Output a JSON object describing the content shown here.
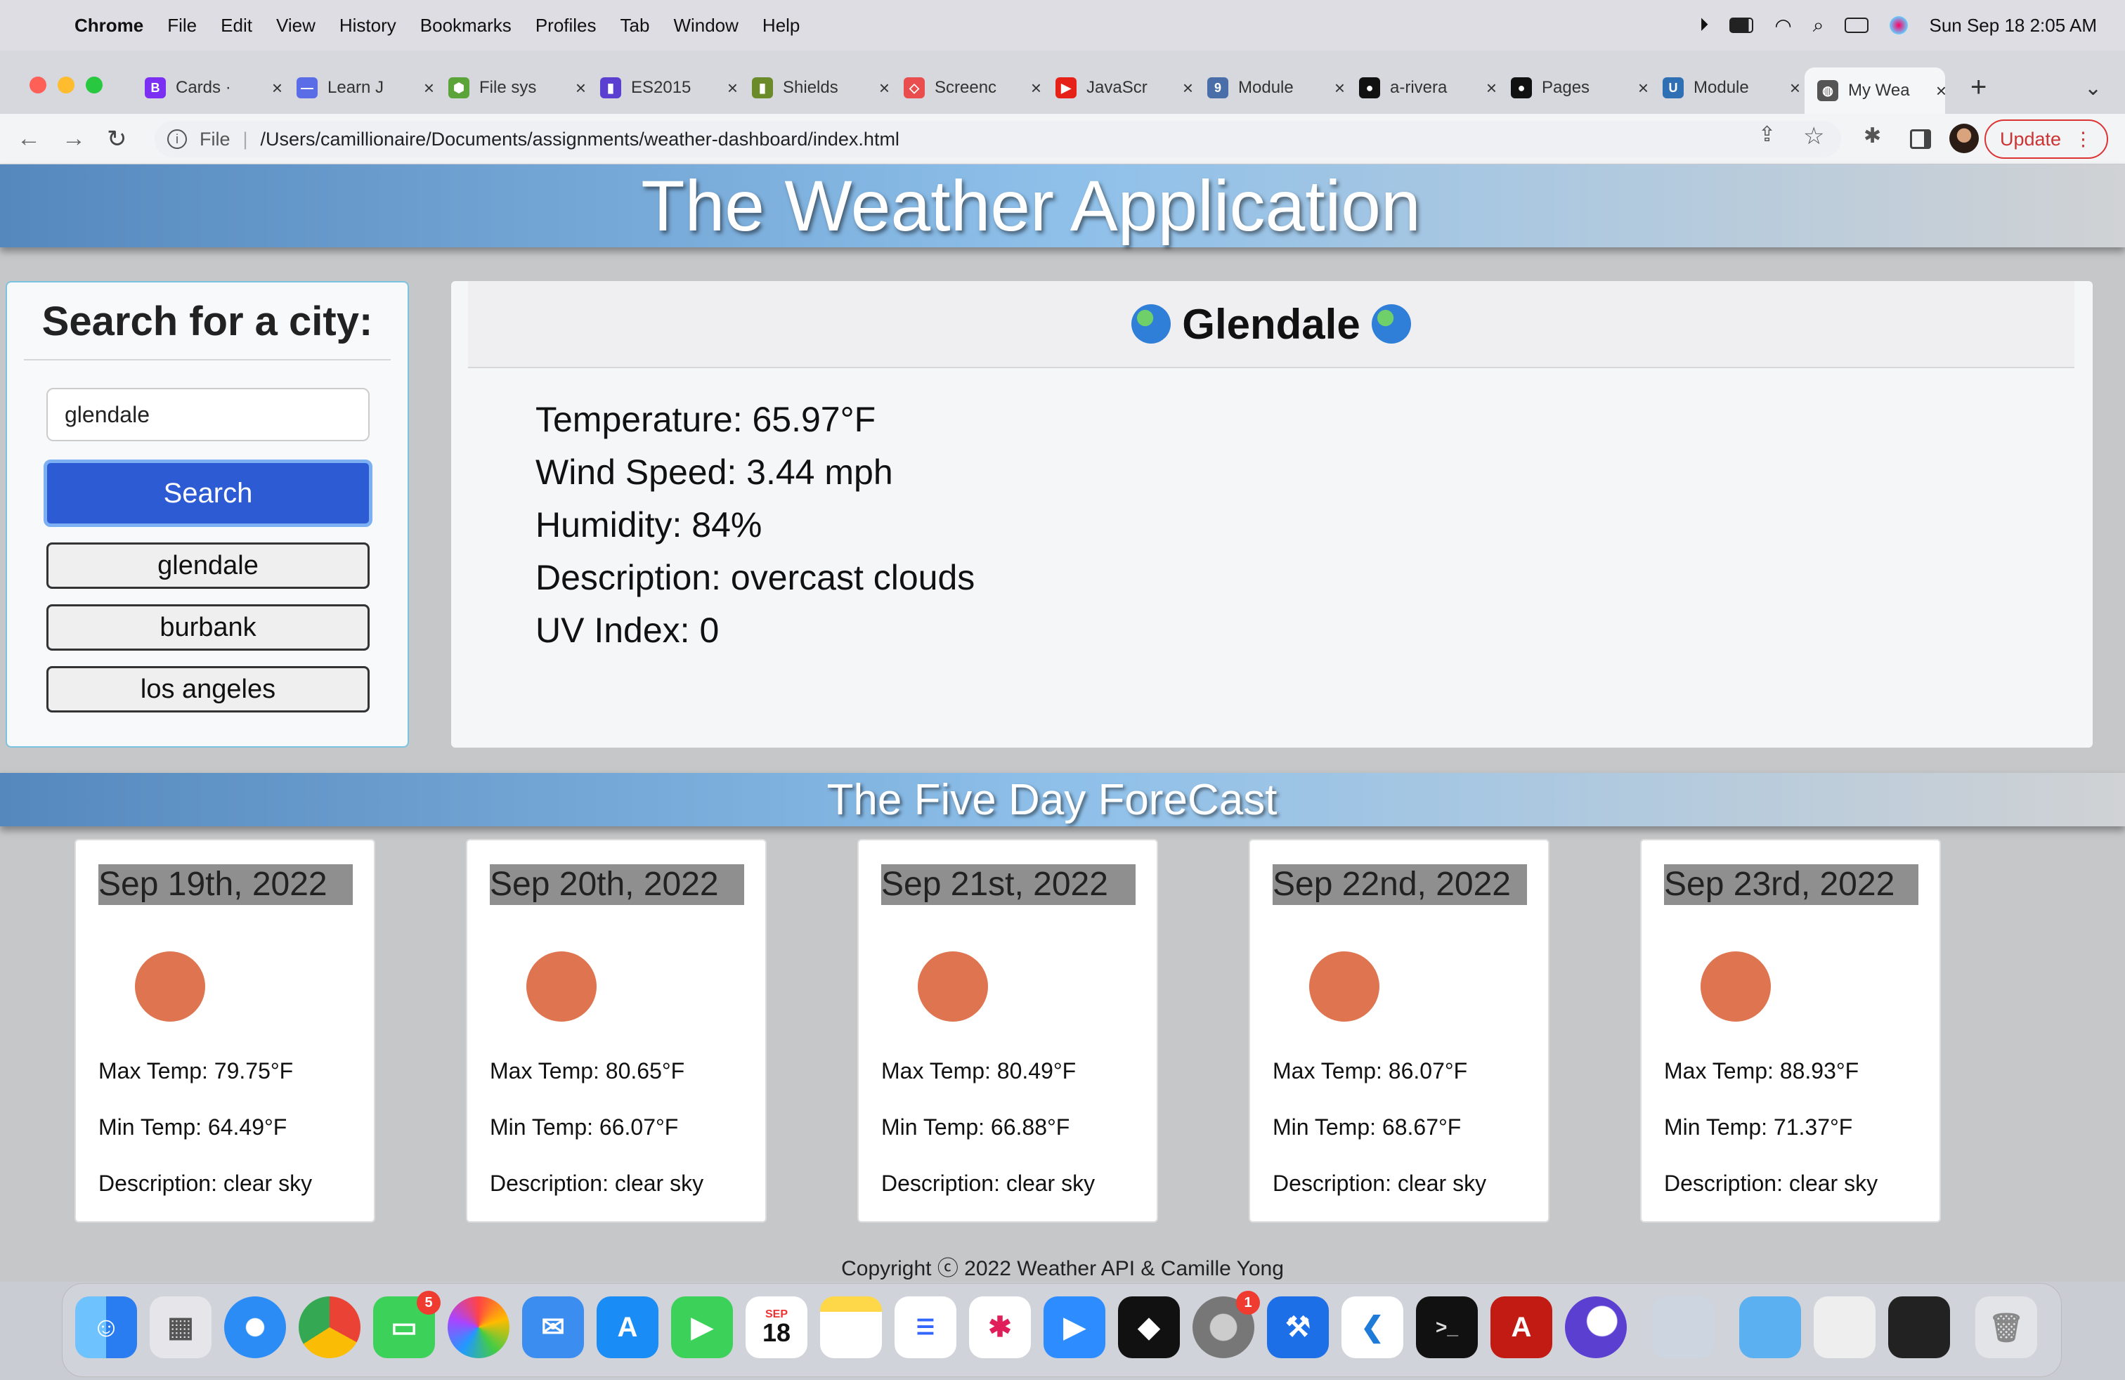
{
  "menubar": {
    "app": "Chrome",
    "items": [
      "File",
      "Edit",
      "View",
      "History",
      "Bookmarks",
      "Profiles",
      "Tab",
      "Window",
      "Help"
    ],
    "clock": "Sun Sep 18  2:05 AM"
  },
  "tabs": [
    {
      "label": "Cards ·",
      "icon": "bootstrap-icon",
      "color": "#7b2ff2",
      "glyph": "B"
    },
    {
      "label": "Learn J",
      "icon": "learn-icon",
      "color": "#5b6de6",
      "glyph": "—"
    },
    {
      "label": "File sys",
      "icon": "node-icon",
      "color": "#5aa43a",
      "glyph": "⬢"
    },
    {
      "label": "ES2015",
      "icon": "es-icon",
      "color": "#5b3fd1",
      "glyph": "▮"
    },
    {
      "label": "Shields",
      "icon": "shields-icon",
      "color": "#6b8b2b",
      "glyph": "▮"
    },
    {
      "label": "Screenc",
      "icon": "screencast-icon",
      "color": "#e94d4d",
      "glyph": "◇"
    },
    {
      "label": "JavaScr",
      "icon": "youtube-icon",
      "color": "#e62117",
      "glyph": "▶"
    },
    {
      "label": "Module",
      "icon": "module-icon",
      "color": "#4a6ea8",
      "glyph": "9"
    },
    {
      "label": "a-rivera",
      "icon": "github-icon",
      "color": "#111",
      "glyph": "●"
    },
    {
      "label": "Pages",
      "icon": "github-icon",
      "color": "#111",
      "glyph": "●"
    },
    {
      "label": "Module",
      "icon": "ucla-icon",
      "color": "#2f6fb4",
      "glyph": "U"
    },
    {
      "label": "My Wea",
      "icon": "globe-icon",
      "color": "#555",
      "glyph": "◍"
    }
  ],
  "address": {
    "scheme": "File",
    "url": "/Users/camillionaire/Documents/assignments/weather-dashboard/index.html",
    "update": "Update"
  },
  "page": {
    "title": "The Weather Application",
    "search": {
      "heading": "Search for a city:",
      "value": "glendale",
      "button": "Search",
      "history": [
        "glendale",
        "burbank",
        "los angeles"
      ]
    },
    "current": {
      "city": "Glendale",
      "temperature": "Temperature: 65.97°F",
      "wind": "Wind Speed: 3.44 mph",
      "humidity": "Humidity: 84%",
      "description": "Description: overcast clouds",
      "uv": "UV Index: 0"
    },
    "forecast_title": "The Five Day ForeCast",
    "forecast": [
      {
        "date": "Sep 19th, 2022",
        "max": "Max Temp: 79.75°F",
        "min": "Min Temp: 64.49°F",
        "desc": "Description: clear sky"
      },
      {
        "date": "Sep 20th, 2022",
        "max": "Max Temp: 80.65°F",
        "min": "Min Temp: 66.07°F",
        "desc": "Description: clear sky"
      },
      {
        "date": "Sep 21st, 2022",
        "max": "Max Temp: 80.49°F",
        "min": "Min Temp: 66.88°F",
        "desc": "Description: clear sky"
      },
      {
        "date": "Sep 22nd, 2022",
        "max": "Max Temp: 86.07°F",
        "min": "Min Temp: 68.67°F",
        "desc": "Description: clear sky"
      },
      {
        "date": "Sep 23rd, 2022",
        "max": "Max Temp: 88.93°F",
        "min": "Min Temp: 71.37°F",
        "desc": "Description: clear sky"
      }
    ],
    "footer": "Copyright ⓒ 2022 Weather API & Camille Yong"
  },
  "dock": {
    "messages_badge": "5",
    "calendar_month": "SEP",
    "calendar_day": "18",
    "settings_badge": "1"
  }
}
